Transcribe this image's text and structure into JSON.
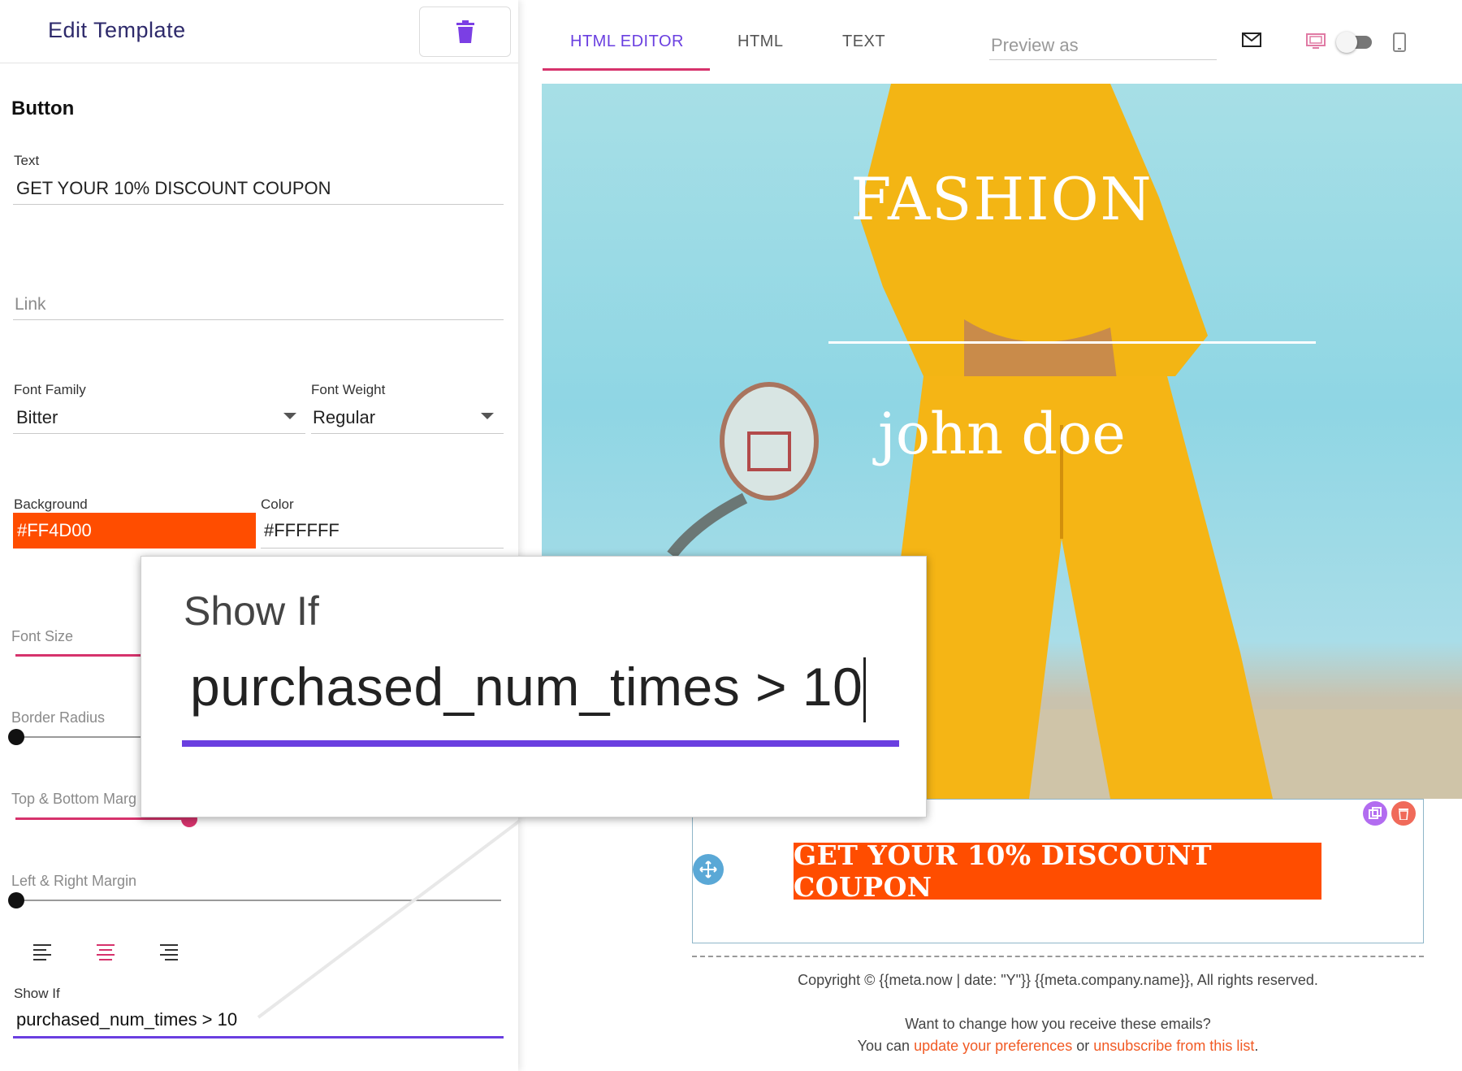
{
  "left_panel": {
    "title": "Edit Template",
    "section_title": "Button",
    "text_field": {
      "label": "Text",
      "value": "GET YOUR 10% DISCOUNT COUPON"
    },
    "link_field": {
      "placeholder": "Link"
    },
    "font_family": {
      "label": "Font Family",
      "value": "Bitter"
    },
    "font_weight": {
      "label": "Font Weight",
      "value": "Regular"
    },
    "background": {
      "label": "Background",
      "value": "#FF4D00"
    },
    "color": {
      "label": "Color",
      "value": "#FFFFFF"
    },
    "sliders": {
      "font_size": {
        "label": "Font Size"
      },
      "border_radius": {
        "label": "Border Radius"
      },
      "top_bottom_margin": {
        "label": "Top & Bottom Marg"
      },
      "left_right_margin": {
        "label": "Left & Right Margin"
      }
    },
    "alignment": {
      "selected": "center"
    },
    "show_if": {
      "label": "Show If",
      "value": "purchased_num_times > 10"
    }
  },
  "right_panel": {
    "tabs": [
      {
        "label": "HTML EDITOR",
        "active": true
      },
      {
        "label": "HTML",
        "active": false
      },
      {
        "label": "TEXT",
        "active": false
      }
    ],
    "preview_as": {
      "placeholder": "Preview as"
    },
    "hero": {
      "title": "FASHION",
      "name": "john doe"
    },
    "cta_label": "GET YOUR 10% DISCOUNT COUPON",
    "footer": {
      "copyright": "Copyright © {{meta.now | date: \"Y\"}} {{meta.company.name}}, All rights reserved.",
      "change_question": "Want to change how you receive these emails?",
      "you_can": "You can",
      "update_link": "update your preferences",
      "or": "or",
      "unsubscribe_link": "unsubscribe from this list",
      "period": "."
    }
  },
  "zoom_callout": {
    "label": "Show If",
    "value": "purchased_num_times > 10"
  },
  "colors": {
    "accent_purple": "#6A3FE0",
    "accent_pink": "#D6336C",
    "cta_orange": "#FF4D00",
    "link_orange": "#F15A24"
  },
  "icons": [
    "trash-icon",
    "envelope-icon",
    "desktop-icon",
    "mobile-icon",
    "dropdown-caret-icon",
    "align-left-icon",
    "align-center-icon",
    "align-right-icon",
    "move-icon",
    "duplicate-icon",
    "delete-icon"
  ]
}
